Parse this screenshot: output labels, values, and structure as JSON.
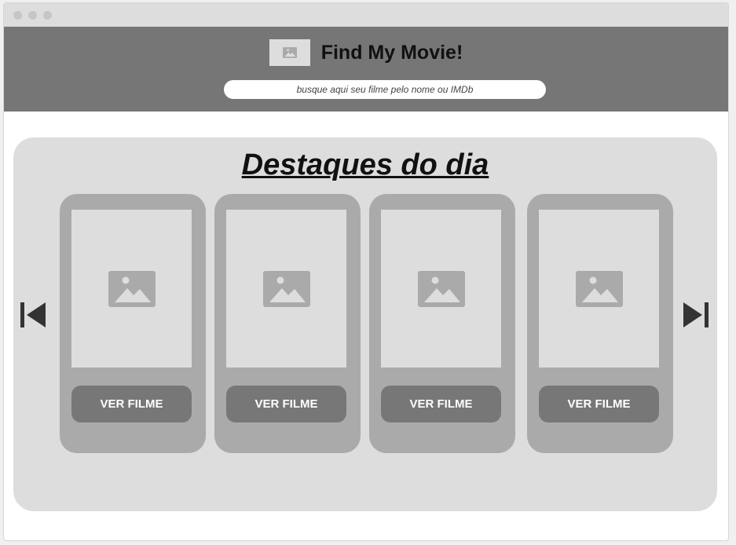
{
  "header": {
    "title": "Find My Movie!",
    "search_placeholder": "busque aqui seu filme pelo nome ou IMDb"
  },
  "featured": {
    "title": "Destaques do dia",
    "cards": [
      {
        "button_label": "VER FILME"
      },
      {
        "button_label": "VER FILME"
      },
      {
        "button_label": "VER FILME"
      },
      {
        "button_label": "VER FILME"
      }
    ]
  },
  "icons": {
    "logo": "image-placeholder-icon",
    "poster": "image-placeholder-icon",
    "prev": "skip-previous-icon",
    "next": "skip-next-icon"
  },
  "colors": {
    "header_bg": "#767676",
    "panel_bg": "#dddddd",
    "card_bg": "#aaaaaa",
    "button_bg": "#777777",
    "nav_icon": "#333333"
  }
}
